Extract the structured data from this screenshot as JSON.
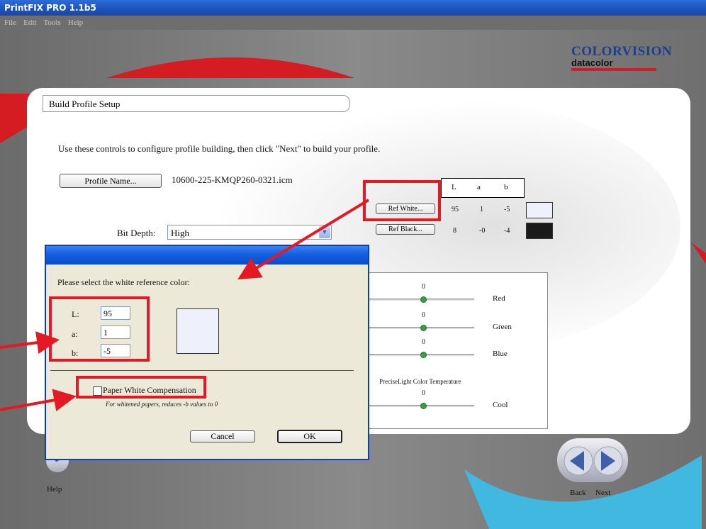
{
  "window": {
    "title": "PrintFIX PRO 1.1b5"
  },
  "menu": [
    "File",
    "Edit",
    "Tools",
    "Help"
  ],
  "brand": {
    "line1": "COLORVISION",
    "line2": "datacolor"
  },
  "section": {
    "title": "Build Profile Setup"
  },
  "instructions": "Use these controls to configure profile building, then click \"Next\" to build your profile.",
  "profile": {
    "button": "Profile Name...",
    "value": "10600-225-KMQP260-0321.icm"
  },
  "bit_depth": {
    "label": "Bit Depth:",
    "value": "High"
  },
  "ref_table": {
    "headers": [
      "L",
      "a",
      "b"
    ],
    "white": {
      "button": "Ref White...",
      "L": "95",
      "a": "1",
      "b": "-5",
      "color": "#eef0fb"
    },
    "black": {
      "button": "Ref Black...",
      "L": "8",
      "a": "-0",
      "b": "-4",
      "color": "#1a1a1a"
    }
  },
  "sliders": [
    {
      "value": "0",
      "label": "Red"
    },
    {
      "value": "0",
      "label": "Green"
    },
    {
      "value": "0",
      "label": "Blue"
    },
    {
      "value": "0",
      "label": "Cool",
      "caption": "PreciseLight Color Temperature"
    }
  ],
  "dialog": {
    "prompt": "Please select the white reference color:",
    "fields": [
      {
        "label": "L:",
        "value": "95"
      },
      {
        "label": "a:",
        "value": "1"
      },
      {
        "label": "b:",
        "value": "-5"
      }
    ],
    "preview_color": "#eef0fb",
    "checkbox": {
      "label": "Paper White Compensation",
      "checked": false
    },
    "note": "For whitened papers, reduces -b values to 0",
    "cancel": "Cancel",
    "ok": "OK"
  },
  "footer": {
    "help": "Help",
    "back": "Back",
    "next": "Next"
  },
  "colors": {
    "accent_red": "#e31923",
    "xp_blue": "#0b4ccc",
    "nav_blue": "#3f5fa8"
  }
}
